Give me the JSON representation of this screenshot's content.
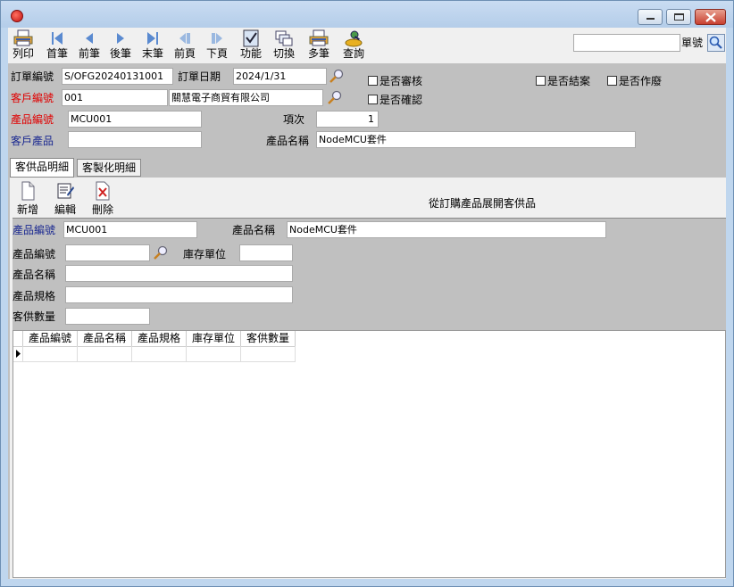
{
  "toolbar": {
    "print": "列印",
    "first": "首筆",
    "prev": "前筆",
    "next": "後筆",
    "last": "末筆",
    "prev_page": "前頁",
    "next_page": "下頁",
    "function": "功能",
    "switch": "切換",
    "multi": "多筆",
    "query": "查詢",
    "search_value": "",
    "search_label": "單號"
  },
  "header": {
    "order_no_label": "訂單編號",
    "order_no": "S/OFG20240131001",
    "order_date_label": "訂單日期",
    "order_date": "2024/1/31",
    "customer_no_label": "客戶編號",
    "customer_no": "001",
    "customer_name": "關慧電子商貿有限公司",
    "product_no_label": "產品編號",
    "product_no": "MCU001",
    "item_label": "項次",
    "item_no": "1",
    "customer_product_label": "客戶產品",
    "customer_product": "",
    "product_name_label": "產品名稱",
    "product_name": "NodeMCU套件",
    "checks": {
      "reviewed": "是否審核",
      "confirmed": "是否確認",
      "closed": "是否結案",
      "voided": "是否作廢"
    }
  },
  "tabs": [
    "客供品明細",
    "客製化明細"
  ],
  "detail": {
    "add": "新增",
    "edit": "編輯",
    "delete": "刪除",
    "expand_note": "從訂購產品展開客供品",
    "product_no_label": "產品編號",
    "product_no": "MCU001",
    "product_name_label": "產品名稱",
    "product_name": "NodeMCU套件",
    "sub_product_no_label": "產品編號",
    "sub_product_no": "",
    "stock_unit_label": "庫存單位",
    "stock_unit": "",
    "sub_product_name_label": "產品名稱",
    "sub_product_name": "",
    "spec_label": "產品規格",
    "spec": "",
    "qty_label": "客供數量",
    "qty": ""
  },
  "grid": {
    "columns": [
      "產品編號",
      "產品名稱",
      "產品規格",
      "庫存單位",
      "客供數量"
    ]
  },
  "colors": {
    "required": "#e00000",
    "key": "#1a2890"
  }
}
